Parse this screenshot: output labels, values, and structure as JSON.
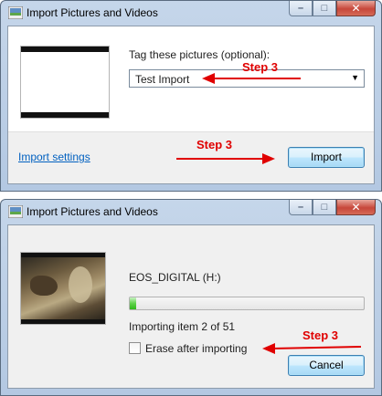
{
  "colors": {
    "annotation": "#e00000",
    "link": "#0060c0",
    "progress": "#2fb81a"
  },
  "import_dialog": {
    "title": "Import Pictures and Videos",
    "icons": [
      "app-icon",
      "minimize-icon",
      "maximize-icon",
      "close-icon"
    ],
    "tag_label": "Tag these pictures (optional):",
    "tag_value": "Test Import",
    "import_settings_link": "Import settings",
    "import_button": "Import",
    "annotation_combo": "Step 3",
    "annotation_button": "Step 3"
  },
  "progress_dialog": {
    "title": "Import Pictures and Videos",
    "device_name": "EOS_DIGITAL (H:)",
    "progress_fraction": 0.026,
    "status_text": "Importing item 2 of 51",
    "erase_label": "Erase after importing",
    "erase_checked": false,
    "cancel_button": "Cancel",
    "annotation_checkbox": "Step 3"
  }
}
